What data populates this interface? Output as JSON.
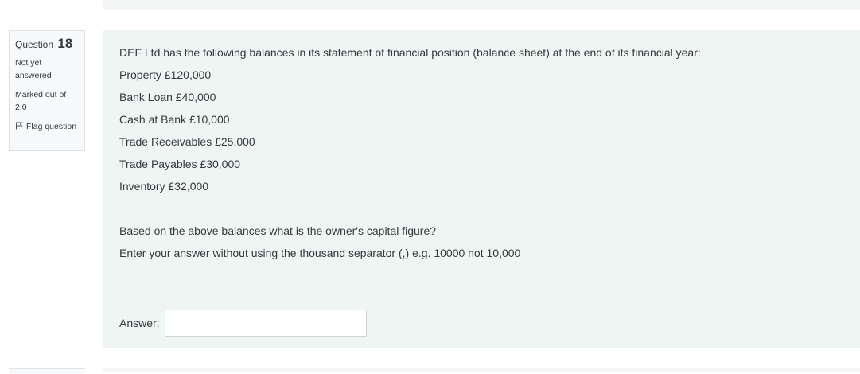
{
  "question_info": {
    "label": "Question",
    "number": "18",
    "state": "Not yet answered",
    "grade": "Marked out of 2.0",
    "flag_label": "Flag question",
    "flag_icon": "flag-icon"
  },
  "question": {
    "intro": "DEF Ltd has the following balances in its statement of financial position (balance sheet) at the end of its financial year:",
    "balances": [
      "Property £120,000",
      "Bank Loan £40,000",
      "Cash at Bank £10,000",
      "Trade Receivables £25,000",
      "Trade Payables £30,000",
      "Inventory £32,000"
    ],
    "prompt": "Based on the above balances what is the owner's capital figure?",
    "instruction": "Enter your answer without using the thousand separator (,) e.g. 10000 not 10,000"
  },
  "answer": {
    "label": "Answer:",
    "value": ""
  },
  "colors": {
    "content_background": "#eef5f2",
    "info_background": "#f8f9fa"
  }
}
